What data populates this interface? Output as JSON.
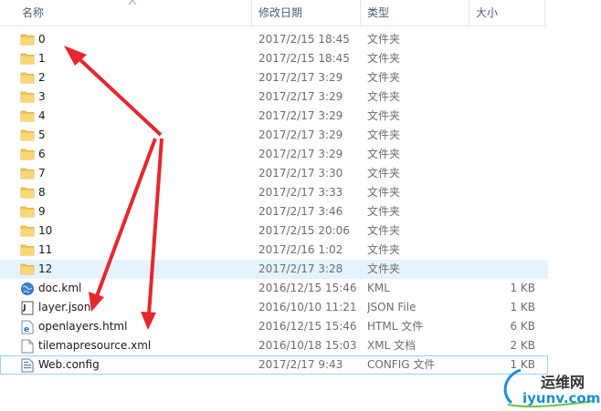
{
  "columns": {
    "name": "名称",
    "date": "修改日期",
    "type": "类型",
    "size": "大小"
  },
  "files": [
    {
      "name": "0",
      "date": "2017/2/15 18:45",
      "type": "文件夹",
      "size": "",
      "icon": "folder-icon"
    },
    {
      "name": "1",
      "date": "2017/2/15 18:45",
      "type": "文件夹",
      "size": "",
      "icon": "folder-icon"
    },
    {
      "name": "2",
      "date": "2017/2/17 3:29",
      "type": "文件夹",
      "size": "",
      "icon": "folder-icon"
    },
    {
      "name": "3",
      "date": "2017/2/17 3:29",
      "type": "文件夹",
      "size": "",
      "icon": "folder-icon"
    },
    {
      "name": "4",
      "date": "2017/2/17 3:29",
      "type": "文件夹",
      "size": "",
      "icon": "folder-icon"
    },
    {
      "name": "5",
      "date": "2017/2/17 3:29",
      "type": "文件夹",
      "size": "",
      "icon": "folder-icon"
    },
    {
      "name": "6",
      "date": "2017/2/17 3:29",
      "type": "文件夹",
      "size": "",
      "icon": "folder-icon"
    },
    {
      "name": "7",
      "date": "2017/2/17 3:30",
      "type": "文件夹",
      "size": "",
      "icon": "folder-icon"
    },
    {
      "name": "8",
      "date": "2017/2/17 3:33",
      "type": "文件夹",
      "size": "",
      "icon": "folder-icon"
    },
    {
      "name": "9",
      "date": "2017/2/17 3:46",
      "type": "文件夹",
      "size": "",
      "icon": "folder-icon"
    },
    {
      "name": "10",
      "date": "2017/2/15 20:06",
      "type": "文件夹",
      "size": "",
      "icon": "folder-icon"
    },
    {
      "name": "11",
      "date": "2017/2/16 1:02",
      "type": "文件夹",
      "size": "",
      "icon": "folder-icon"
    },
    {
      "name": "12",
      "date": "2017/2/17 3:28",
      "type": "文件夹",
      "size": "",
      "icon": "folder-icon",
      "state": "hover"
    },
    {
      "name": "doc.kml",
      "date": "2016/12/15 15:46",
      "type": "KML",
      "size": "1 KB",
      "icon": "globe-kml-icon"
    },
    {
      "name": "layer.json",
      "date": "2016/10/10 11:21",
      "type": "JSON File",
      "size": "1 KB",
      "icon": "json-file-icon"
    },
    {
      "name": "openlayers.html",
      "date": "2016/12/15 15:46",
      "type": "HTML 文件",
      "size": "6 KB",
      "icon": "html-file-icon"
    },
    {
      "name": "tilemapresource.xml",
      "date": "2016/10/18 15:03",
      "type": "XML 文档",
      "size": "2 KB",
      "icon": "xml-file-icon"
    },
    {
      "name": "Web.config",
      "date": "2017/2/17 9:43",
      "type": "CONFIG 文件",
      "size": "1 KB",
      "icon": "config-file-icon",
      "state": "selected"
    }
  ],
  "watermark": {
    "line1": "运维网",
    "line2": "iyunv.com"
  },
  "colors": {
    "annotation_arrow": "#e8262d",
    "folder": "#f3c55a",
    "hover_row": "#e5f3ff",
    "selected_border": "#99d1ff"
  }
}
